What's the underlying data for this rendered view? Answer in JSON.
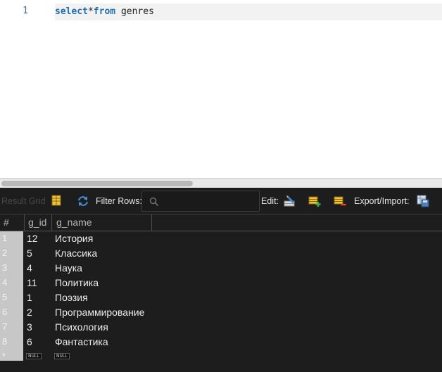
{
  "editor": {
    "line_number": "1",
    "keyword_select": "select",
    "operator": "*",
    "keyword_from": "from",
    "table_name": "genres"
  },
  "toolbar": {
    "result_grid_label": "Result Grid",
    "filter_rows_label": "Filter Rows:",
    "search_placeholder": "",
    "edit_label": "Edit:",
    "export_import_label": "Export/Import:"
  },
  "grid": {
    "columns": [
      {
        "label": "#"
      },
      {
        "label": "g_id"
      },
      {
        "label": "g_name"
      }
    ],
    "rows": [
      {
        "num": "1",
        "g_id": "12",
        "g_name": "История"
      },
      {
        "num": "2",
        "g_id": "5",
        "g_name": "Классика"
      },
      {
        "num": "3",
        "g_id": "4",
        "g_name": "Наука"
      },
      {
        "num": "4",
        "g_id": "11",
        "g_name": "Политика"
      },
      {
        "num": "5",
        "g_id": "1",
        "g_name": "Поэзия"
      },
      {
        "num": "6",
        "g_id": "2",
        "g_name": "Программирование"
      },
      {
        "num": "7",
        "g_id": "3",
        "g_name": "Психология"
      },
      {
        "num": "8",
        "g_id": "6",
        "g_name": "Фантастика"
      }
    ],
    "new_row": {
      "num": "*",
      "g_id": "NULL",
      "g_name": "NULL"
    }
  },
  "colors": {
    "keyword": "#1f6fb4",
    "grid_background": "#1d1d1d",
    "row_number_column": "#c7c7c7"
  },
  "icons": [
    "grid-layout-icon",
    "refresh-icon",
    "search-icon",
    "edit-row-icon",
    "add-row-icon",
    "delete-row-icon",
    "export-icon"
  ]
}
